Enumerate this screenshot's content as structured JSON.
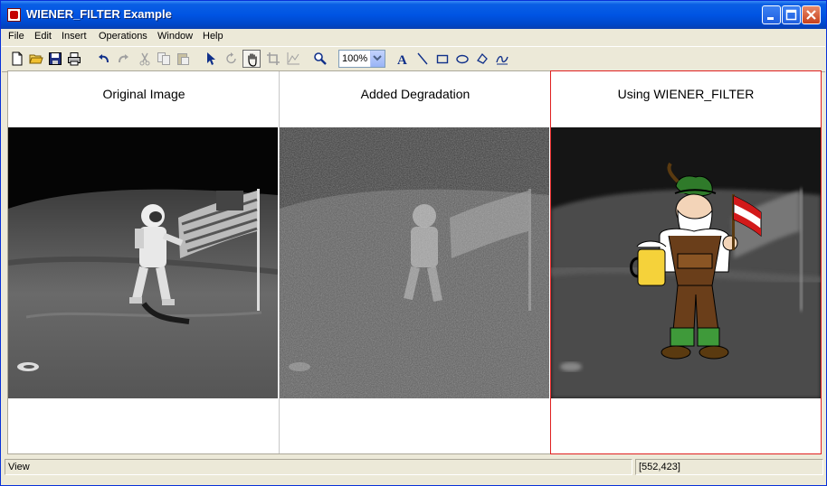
{
  "window": {
    "title": "WIENER_FILTER Example",
    "title_bar_color": "#0054e3"
  },
  "menubar": {
    "items": [
      {
        "label": "File"
      },
      {
        "label": "Edit"
      },
      {
        "label": "Insert"
      },
      {
        "label": "Operations"
      },
      {
        "label": "Window"
      },
      {
        "label": "Help"
      }
    ]
  },
  "toolbar": {
    "buttons": [
      {
        "icon": "new-file-icon"
      },
      {
        "icon": "open-folder-icon"
      },
      {
        "icon": "save-icon"
      },
      {
        "icon": "print-icon"
      },
      {
        "icon": "undo-icon"
      },
      {
        "icon": "redo-icon"
      },
      {
        "icon": "cut-icon"
      },
      {
        "icon": "copy-icon"
      },
      {
        "icon": "paste-icon"
      },
      {
        "icon": "select-arrow-icon"
      },
      {
        "icon": "rotate-icon"
      },
      {
        "icon": "pan-hand-icon",
        "pressed": true
      },
      {
        "icon": "crop-icon"
      },
      {
        "icon": "profile-icon"
      },
      {
        "icon": "zoom-magnifier-icon"
      },
      {
        "icon": "text-annotation-icon"
      },
      {
        "icon": "line-tool-icon"
      },
      {
        "icon": "rectangle-tool-icon"
      },
      {
        "icon": "ellipse-tool-icon"
      },
      {
        "icon": "polygon-tool-icon"
      },
      {
        "icon": "freehand-tool-icon"
      }
    ],
    "zoom": {
      "value": "100%"
    }
  },
  "panels": [
    {
      "title": "Original Image"
    },
    {
      "title": "Added Degradation"
    },
    {
      "title": "Using WIENER_FILTER",
      "selected": true,
      "selection_color": "#e02020"
    }
  ],
  "statusbar": {
    "text": "View",
    "coordinates": "[552,423]"
  }
}
